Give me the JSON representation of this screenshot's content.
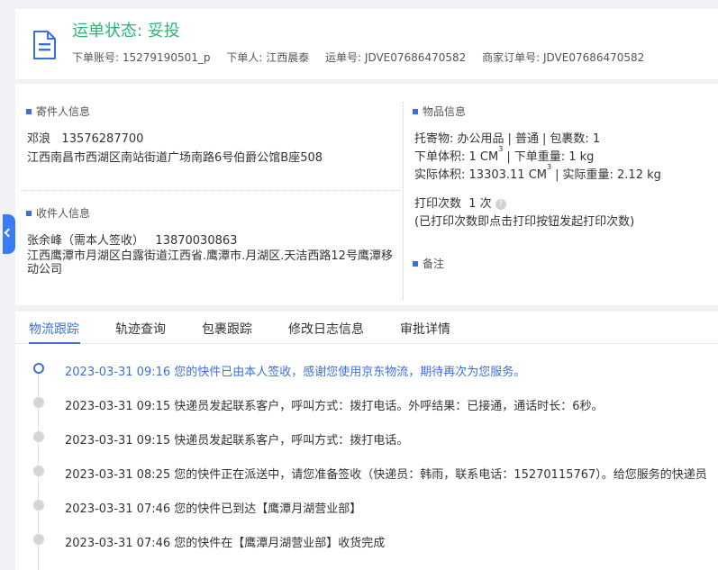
{
  "header": {
    "status_label": "运单状态:",
    "status_value": "妥投",
    "meta": [
      {
        "label": "下单账号:",
        "value": "15279190501_p"
      },
      {
        "label": "下单人:",
        "value": "江西晨泰"
      },
      {
        "label": "运单号:",
        "value": "JDVE07686470582"
      },
      {
        "label": "商家订单号:",
        "value": "JDVE07686470582"
      }
    ]
  },
  "sender": {
    "title": "寄件人信息",
    "name": "邓浪",
    "phone": "13576287700",
    "address": "江西南昌市西湖区南站街道广场南路6号伯爵公馆B座508"
  },
  "receiver": {
    "title": "收件人信息",
    "name": "张余峰（需本人签收）",
    "phone": "13870030863",
    "address": "江西鹰潭市月湖区白露街道江西省.鹰潭市.月湖区.天洁西路12号鹰潭移动公司"
  },
  "goods": {
    "title": "物品信息",
    "item_label": "托寄物:",
    "item_value": "办公用品",
    "type_value": "普通",
    "pkg_label": "包裹数:",
    "pkg_value": "1",
    "order_vol_label": "下单体积:",
    "order_vol_value": "1 CM",
    "order_wt_label": "下单重量:",
    "order_wt_value": "1 kg",
    "actual_vol_label": "实际体积:",
    "actual_vol_value": "13303.11 CM",
    "actual_wt_label": "实际重量:",
    "actual_wt_value": "2.12 kg",
    "vol_exponent": "3",
    "print_label": "打印次数",
    "print_value": "1 次",
    "print_note": "(已打印次数即点击打印按钮发起打印次数)"
  },
  "remark": {
    "title": "备注"
  },
  "tabs": [
    "物流跟踪",
    "轨迹查询",
    "包裹跟踪",
    "修改日志信息",
    "审批详情"
  ],
  "timeline": [
    {
      "time": "2023-03-31 09:16",
      "text": "您的快件已由本人签收，感谢您使用京东物流，期待再次为您服务。"
    },
    {
      "time": "2023-03-31 09:15",
      "text": "快递员发起联系客户，呼叫方式：拨打电话。外呼结果：已接通，通话时长：6秒。"
    },
    {
      "time": "2023-03-31 09:15",
      "text": "快递员发起联系客户，呼叫方式：拨打电话。"
    },
    {
      "time": "2023-03-31 08:25",
      "text": "您的快件正在派送中，请您准备签收（快递员：韩雨，联系电话：15270115767）。给您服务的快递员"
    },
    {
      "time": "2023-03-31 07:46",
      "text": "您的快件已到达【鹰潭月湖营业部】"
    },
    {
      "time": "2023-03-31 07:46",
      "text": "您的快件在【鹰潭月湖营业部】收货完成"
    }
  ],
  "colors": {
    "accent": "#3b6fe0",
    "status": "#2bb673"
  }
}
